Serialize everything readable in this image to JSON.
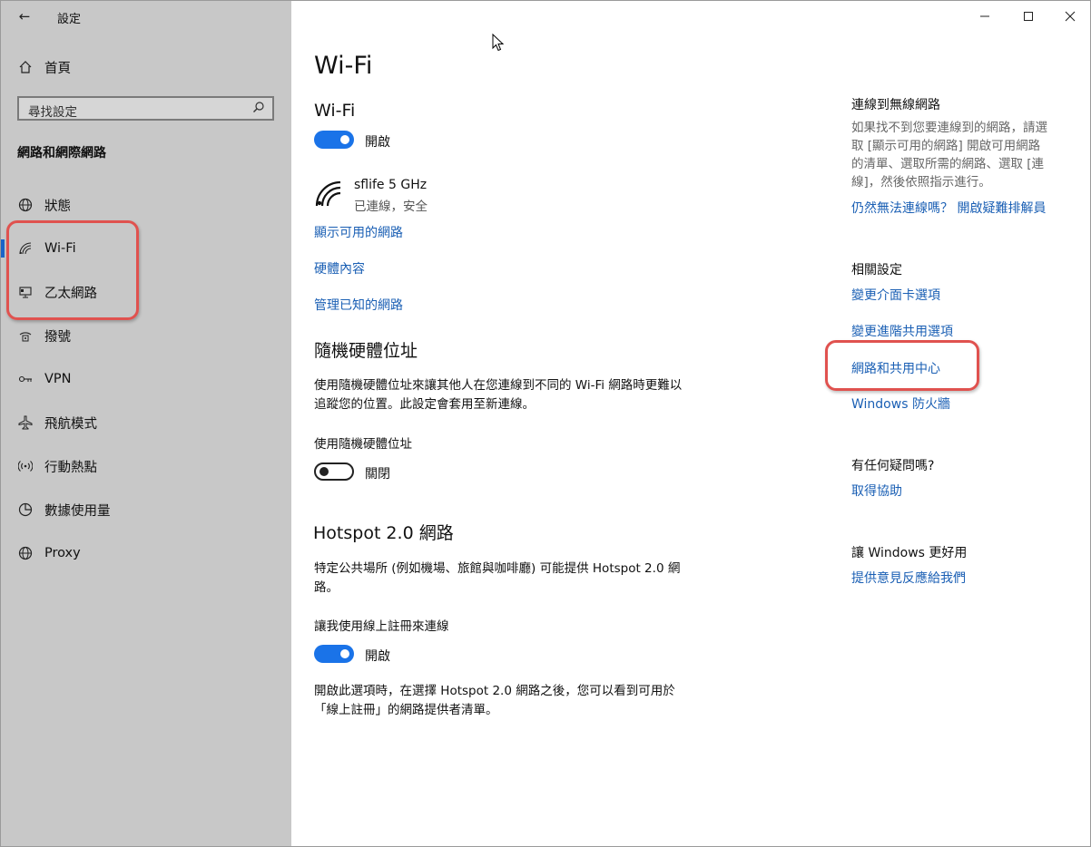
{
  "window": {
    "title": "設定",
    "controls": [
      "minimize",
      "maximize",
      "close"
    ]
  },
  "sidebar": {
    "home_label": "首頁",
    "search_placeholder": "尋找設定",
    "section_title": "網路和網際網路",
    "items": [
      {
        "label": "狀態",
        "icon": "globe-status-icon"
      },
      {
        "label": "Wi-Fi",
        "icon": "wifi-icon",
        "active": true
      },
      {
        "label": "乙太網路",
        "icon": "ethernet-icon"
      },
      {
        "label": "撥號",
        "icon": "dialup-icon"
      },
      {
        "label": "VPN",
        "icon": "vpn-icon"
      },
      {
        "label": "飛航模式",
        "icon": "airplane-icon"
      },
      {
        "label": "行動熱點",
        "icon": "hotspot-icon"
      },
      {
        "label": "數據使用量",
        "icon": "data-usage-icon"
      },
      {
        "label": "Proxy",
        "icon": "proxy-globe-icon"
      }
    ]
  },
  "main": {
    "page_title": "Wi-Fi",
    "wifi_heading": "Wi-Fi",
    "wifi_toggle_label": "開啟",
    "network": {
      "name": "sflife 5 GHz",
      "status": "已連線，安全"
    },
    "links": {
      "show_available": "顯示可用的網路",
      "hardware_props": "硬體內容",
      "manage_known": "管理已知的網路"
    },
    "random_mac": {
      "heading": "隨機硬體位址",
      "desc_line1": "使用隨機硬體位址來讓其他人在您連線到不同的 Wi-Fi 網路時更難以",
      "desc_line2": "追蹤您的位置。此設定會套用至新連線。",
      "toggle_caption": "使用隨機硬體位址",
      "toggle_label": "關閉"
    },
    "hotspot20": {
      "heading": "Hotspot 2.0 網路",
      "desc_line1": "特定公共場所 (例如機場、旅館與咖啡廳) 可能提供 Hotspot 2.0 網",
      "desc_line2": "路。",
      "toggle_caption": "讓我使用線上註冊來連線",
      "toggle_label": "開啟",
      "note_line1": "開啟此選項時，在選擇 Hotspot 2.0 網路之後，您可以看到可用於",
      "note_line2": "「線上註冊」的網路提供者清單。"
    }
  },
  "right_panel": {
    "connect_heading": "連線到無線網路",
    "connect_text_line1": "如果找不到您要連線到的網路，請選",
    "connect_text_line2": "取 [顯示可用的網路] 開啟可用網路",
    "connect_text_line3": "的清單、選取所需的網路、選取 [連",
    "connect_text_line4": "線]，然後依照指示進行。",
    "troubleshoot_link": "仍然無法連線嗎？ 開啟疑難排解員",
    "related_heading": "相關設定",
    "related_links": [
      "變更介面卡選項",
      "變更進階共用選項",
      "網路和共用中心",
      "Windows 防火牆"
    ],
    "help_heading": "有任何疑問嗎?",
    "help_link": "取得協助",
    "better_heading": "讓 Windows 更好用",
    "feedback_link": "提供意見反應給我們"
  },
  "colors": {
    "accent": "#1a73e8",
    "link": "#1a5fb4",
    "callout": "#e0524f",
    "sidebar_bg": "#c8c8c8"
  }
}
